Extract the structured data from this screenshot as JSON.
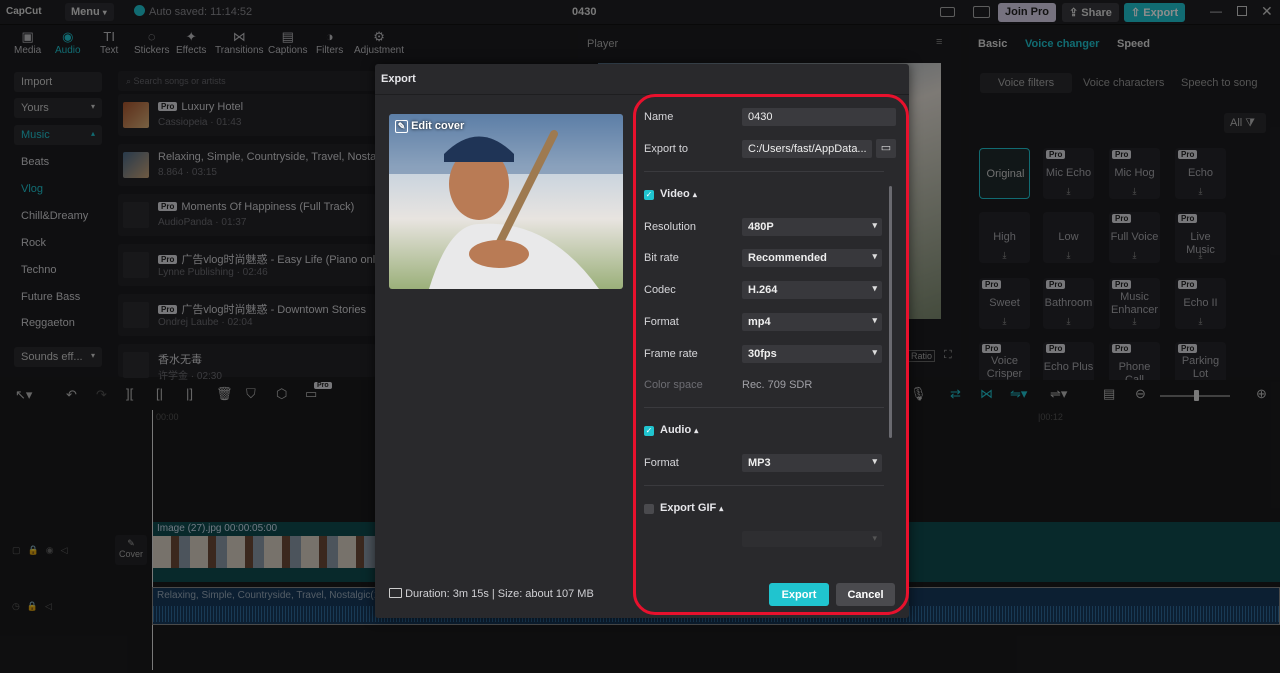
{
  "app": {
    "logo": "CapCut",
    "menu": "Menu",
    "autosave": "Auto saved: 11:14:52",
    "project": "0430",
    "join_pro": "Join Pro",
    "share": "Share",
    "export": "Export"
  },
  "toolbar": [
    {
      "label": "Media",
      "glyph": "▣"
    },
    {
      "label": "Audio",
      "glyph": "◉"
    },
    {
      "label": "Text",
      "glyph": "TI"
    },
    {
      "label": "Stickers",
      "glyph": "◌"
    },
    {
      "label": "Effects",
      "glyph": "✦"
    },
    {
      "label": "Transitions",
      "glyph": "⋈"
    },
    {
      "label": "Captions",
      "glyph": "▤"
    },
    {
      "label": "Filters",
      "glyph": "◑"
    },
    {
      "label": "Adjustment",
      "glyph": "⚙"
    }
  ],
  "audio_nav": {
    "import": "Import",
    "yours": "Yours",
    "music": "Music",
    "categories": [
      "Beats",
      "Vlog",
      "Chill&Dreamy",
      "Rock",
      "Techno",
      "Future Bass",
      "Reggaeton"
    ],
    "sound_effects": "Sounds eff..."
  },
  "search": {
    "placeholder": "Search songs or artists"
  },
  "songs": [
    {
      "title": "Luxury Hotel",
      "sub": "Cassiopeia · 01:43",
      "pro": true
    },
    {
      "title": "Relaxing, Simple, Countryside, Travel, Nostalgic",
      "sub": "8.864 · 03:15",
      "pro": false
    },
    {
      "title": "Moments Of Happiness (Full Track)",
      "sub": "AudioPanda · 01:37",
      "pro": true
    },
    {
      "title": "广告vlog时尚魅惑 - Easy Life (Piano only)",
      "sub": "Lynne Publishing · 02:46",
      "pro": true
    },
    {
      "title": "广告vlog时尚魅惑 - Downtown Stories",
      "sub": "Ondrej Laube · 02:04",
      "pro": true
    },
    {
      "title": "香水无毒",
      "sub": "许学金 · 02:30",
      "pro": false
    }
  ],
  "player": {
    "title": "Player",
    "ratio": "Ratio"
  },
  "right": {
    "tabs": [
      "Basic",
      "Voice changer",
      "Speed"
    ],
    "subtabs": [
      "Voice filters",
      "Voice characters",
      "Speech to song"
    ],
    "all": "All",
    "voices": [
      {
        "name": "Original",
        "pro": false,
        "dl": false
      },
      {
        "name": "Mic Echo",
        "pro": true,
        "dl": true
      },
      {
        "name": "Mic Hog",
        "pro": true,
        "dl": true
      },
      {
        "name": "Echo",
        "pro": true,
        "dl": true
      },
      {
        "name": "High",
        "pro": false,
        "dl": true
      },
      {
        "name": "Low",
        "pro": false,
        "dl": true
      },
      {
        "name": "Full Voice",
        "pro": true,
        "dl": true
      },
      {
        "name": "Live Music",
        "pro": true,
        "dl": true
      },
      {
        "name": "Sweet",
        "pro": true,
        "dl": true
      },
      {
        "name": "Bathroom",
        "pro": true,
        "dl": true
      },
      {
        "name": "Music Enhancer",
        "pro": true,
        "dl": true
      },
      {
        "name": "Echo II",
        "pro": true,
        "dl": true
      },
      {
        "name": "Voice Crisper",
        "pro": true,
        "dl": false
      },
      {
        "name": "Echo Plus",
        "pro": true,
        "dl": false
      },
      {
        "name": "Phone Call",
        "pro": true,
        "dl": false
      },
      {
        "name": "Parking Lot",
        "pro": true,
        "dl": false
      }
    ],
    "pro_label": "Pro"
  },
  "timeline": {
    "ruler_start": "00:00",
    "ruler_mark": "|00:12",
    "video_clip": "Image (27).jpg  00:00:05:00",
    "audio_clip": "Relaxing, Simple, Countryside, Travel, Nostalgic(13)",
    "cover": "Cover",
    "pro": "Pro"
  },
  "dialog": {
    "title": "Export",
    "edit_cover": "Edit cover",
    "name_label": "Name",
    "name_value": "0430",
    "export_to_label": "Export to",
    "export_to_value": "C:/Users/fast/AppData...",
    "video_label": "Video",
    "resolution_label": "Resolution",
    "resolution_value": "480P",
    "bitrate_label": "Bit rate",
    "bitrate_value": "Recommended",
    "codec_label": "Codec",
    "codec_value": "H.264",
    "format_label": "Format",
    "format_value": "mp4",
    "framerate_label": "Frame rate",
    "framerate_value": "30fps",
    "colorspace_label": "Color space",
    "colorspace_value": "Rec. 709 SDR",
    "audio_label": "Audio",
    "audio_format_label": "Format",
    "audio_format_value": "MP3",
    "gif_label": "Export GIF",
    "duration": "Duration: 3m 15s | Size: about 107 MB",
    "export_btn": "Export",
    "cancel_btn": "Cancel"
  },
  "colors": {
    "accent": "#20c4cf",
    "highlight": "#e8112d",
    "pro_badge": "#d9d9de"
  }
}
